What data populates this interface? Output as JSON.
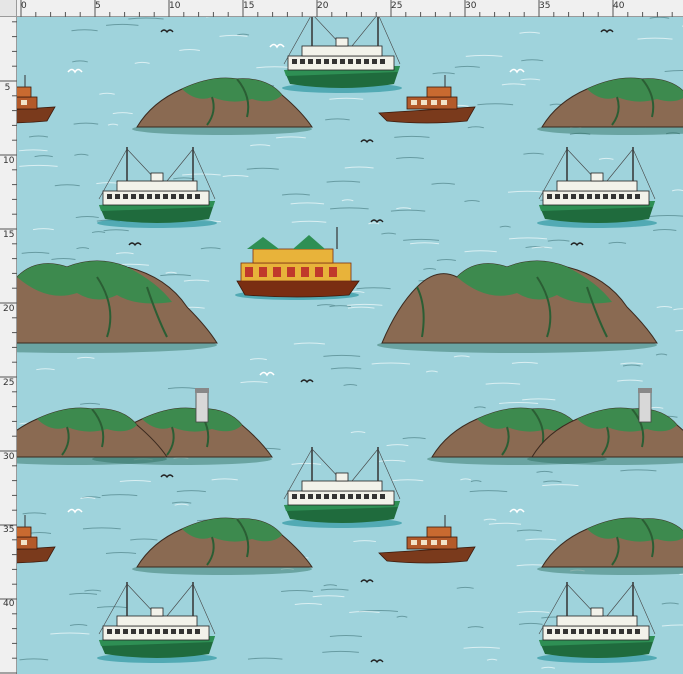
{
  "ruler": {
    "top_labels": [
      "0",
      "5",
      "10",
      "15",
      "20",
      "25",
      "30",
      "35",
      "40"
    ],
    "left_labels": [
      "5",
      "10",
      "15",
      "20",
      "25",
      "30",
      "35",
      "40"
    ]
  },
  "colors": {
    "water": "#9fd3dc",
    "ferry_green": "#1f6b3d",
    "ferry_white": "#f2f2ea",
    "rock_brown": "#8a6a52",
    "rock_green": "#3d8a4e",
    "sampan_brown": "#7a3a1c",
    "junk_yellow": "#e8b33a"
  },
  "pattern": {
    "icons": [
      "star-ferry-icon",
      "island-icon",
      "sampan-icon",
      "junk-boat-icon",
      "lighthouse-icon",
      "seagull-icon"
    ]
  }
}
